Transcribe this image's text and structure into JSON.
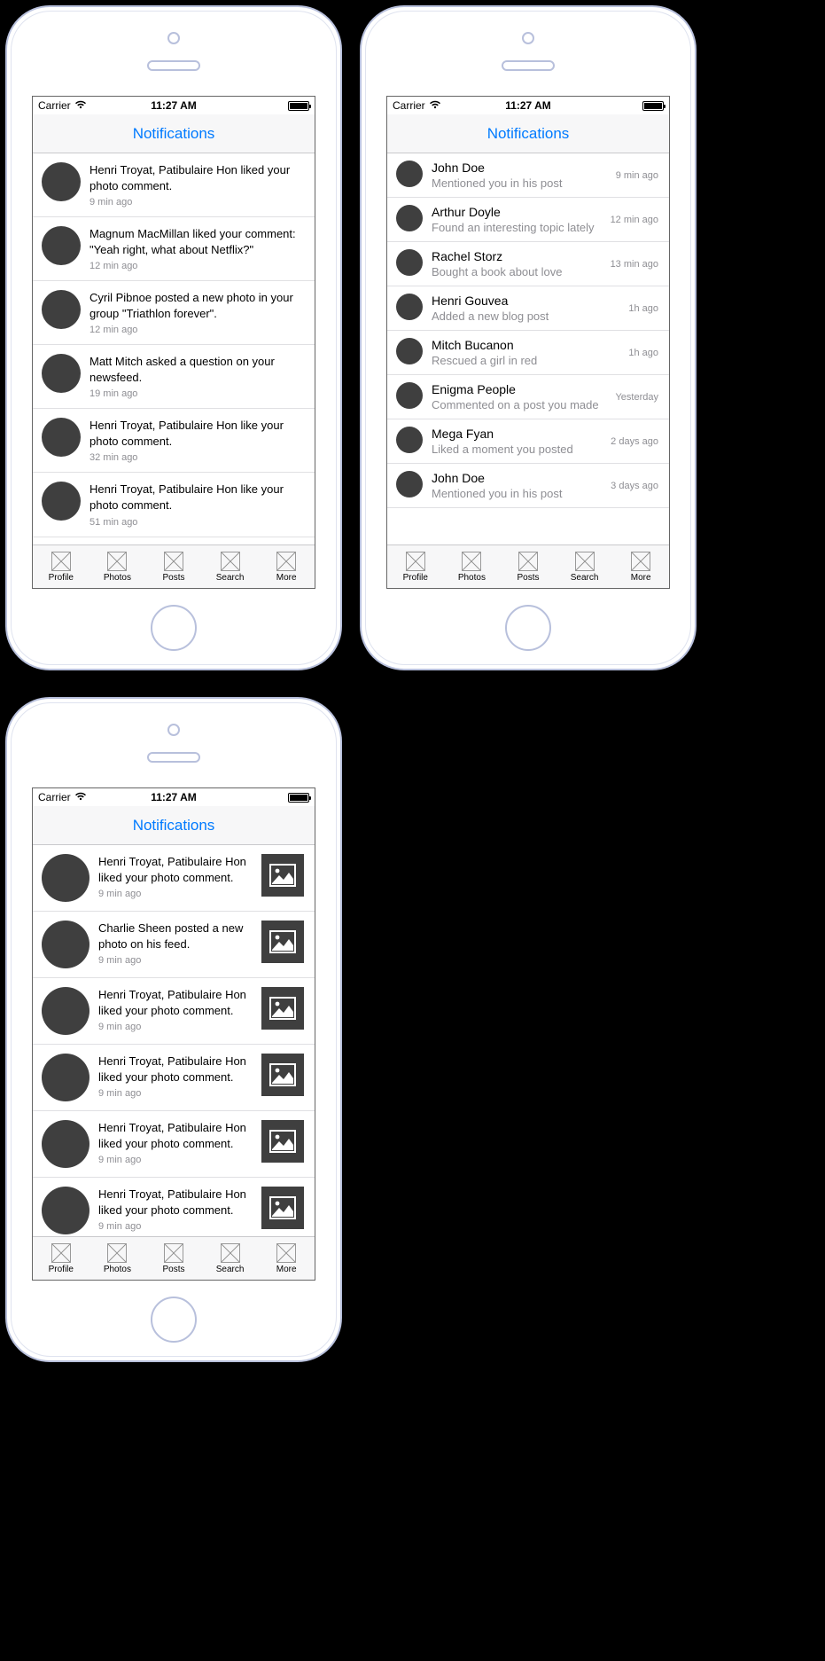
{
  "statusBar": {
    "carrier": "Carrier",
    "time": "11:27 AM"
  },
  "navTitle": "Notifications",
  "tabs": [
    {
      "label": "Profile"
    },
    {
      "label": "Photos"
    },
    {
      "label": "Posts"
    },
    {
      "label": "Search"
    },
    {
      "label": "More"
    }
  ],
  "screen1": {
    "items": [
      {
        "text": "Henri Troyat, Patibulaire Hon liked your photo comment.",
        "time": "9 min ago"
      },
      {
        "text": "Magnum MacMillan liked your comment: \"Yeah right, what about Netflix?\"",
        "time": "12 min ago"
      },
      {
        "text": "Cyril Pibnoe posted a new photo in your group \"Triathlon forever\".",
        "time": "12 min ago"
      },
      {
        "text": "Matt Mitch asked a question on your newsfeed.",
        "time": "19 min ago"
      },
      {
        "text": "Henri Troyat, Patibulaire Hon like your photo comment.",
        "time": "32 min ago"
      },
      {
        "text": "Henri Troyat, Patibulaire Hon like your photo comment.",
        "time": "51 min ago"
      }
    ]
  },
  "screen2": {
    "items": [
      {
        "name": "John Doe",
        "sub": "Mentioned you in his post",
        "time": "9 min ago"
      },
      {
        "name": "Arthur Doyle",
        "sub": "Found an interesting topic lately",
        "time": "12 min ago"
      },
      {
        "name": "Rachel Storz",
        "sub": "Bought a book about love",
        "time": "13 min ago"
      },
      {
        "name": "Henri Gouvea",
        "sub": "Added a new blog post",
        "time": "1h ago"
      },
      {
        "name": "Mitch Bucanon",
        "sub": "Rescued a girl in red",
        "time": "1h ago"
      },
      {
        "name": "Enigma People",
        "sub": "Commented on a post you made",
        "time": "Yesterday"
      },
      {
        "name": "Mega Fyan",
        "sub": "Liked a moment you posted",
        "time": "2 days ago"
      },
      {
        "name": "John Doe",
        "sub": "Mentioned you in his post",
        "time": "3 days ago"
      }
    ]
  },
  "screen3": {
    "items": [
      {
        "text": "Henri Troyat, Patibulaire Hon liked your photo comment.",
        "time": "9 min ago"
      },
      {
        "text": "Charlie Sheen posted a new photo on his feed.",
        "time": "9 min ago"
      },
      {
        "text": "Henri Troyat, Patibulaire Hon liked your photo comment.",
        "time": "9 min ago"
      },
      {
        "text": "Henri Troyat, Patibulaire Hon liked your photo comment.",
        "time": "9 min ago"
      },
      {
        "text": "Henri Troyat, Patibulaire Hon liked your photo comment.",
        "time": "9 min ago"
      },
      {
        "text": "Henri Troyat, Patibulaire Hon liked your photo comment.",
        "time": "9 min ago"
      }
    ]
  }
}
